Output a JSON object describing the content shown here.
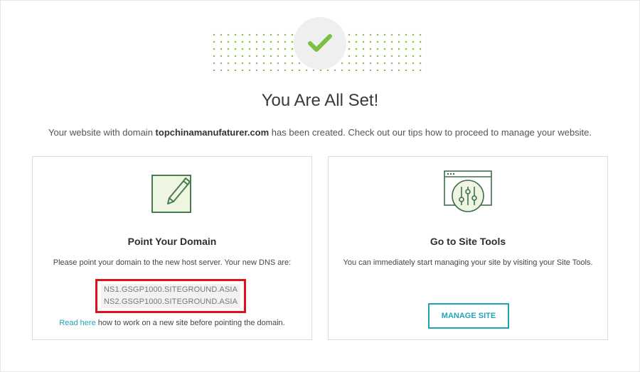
{
  "hero": {
    "title": "You Are All Set!",
    "subtitle_prefix": "Your website with domain ",
    "domain": "topchinamanufaturer.com",
    "subtitle_suffix": " has been created. Check out our tips how to proceed to manage your website.",
    "icon": "checkmark-icon",
    "accent": "#7ac142"
  },
  "cards": {
    "point_domain": {
      "icon": "edit-note-icon",
      "title": "Point Your Domain",
      "description": "Please point your domain to the new host server. Your new DNS are:",
      "dns": [
        "NS1.GSGP1000.SITEGROUND.ASIA",
        "NS2.GSGP1000.SITEGROUND.ASIA"
      ],
      "read_here_link": "Read here",
      "read_here_text": " how to work on a new site before pointing the domain.",
      "highlight_color": "#e0101a"
    },
    "site_tools": {
      "icon": "site-tools-sliders-icon",
      "title": "Go to Site Tools",
      "description": "You can immediately start managing your site by visiting your Site Tools.",
      "button_label": "MANAGE SITE",
      "button_color": "#22a3b5"
    }
  }
}
